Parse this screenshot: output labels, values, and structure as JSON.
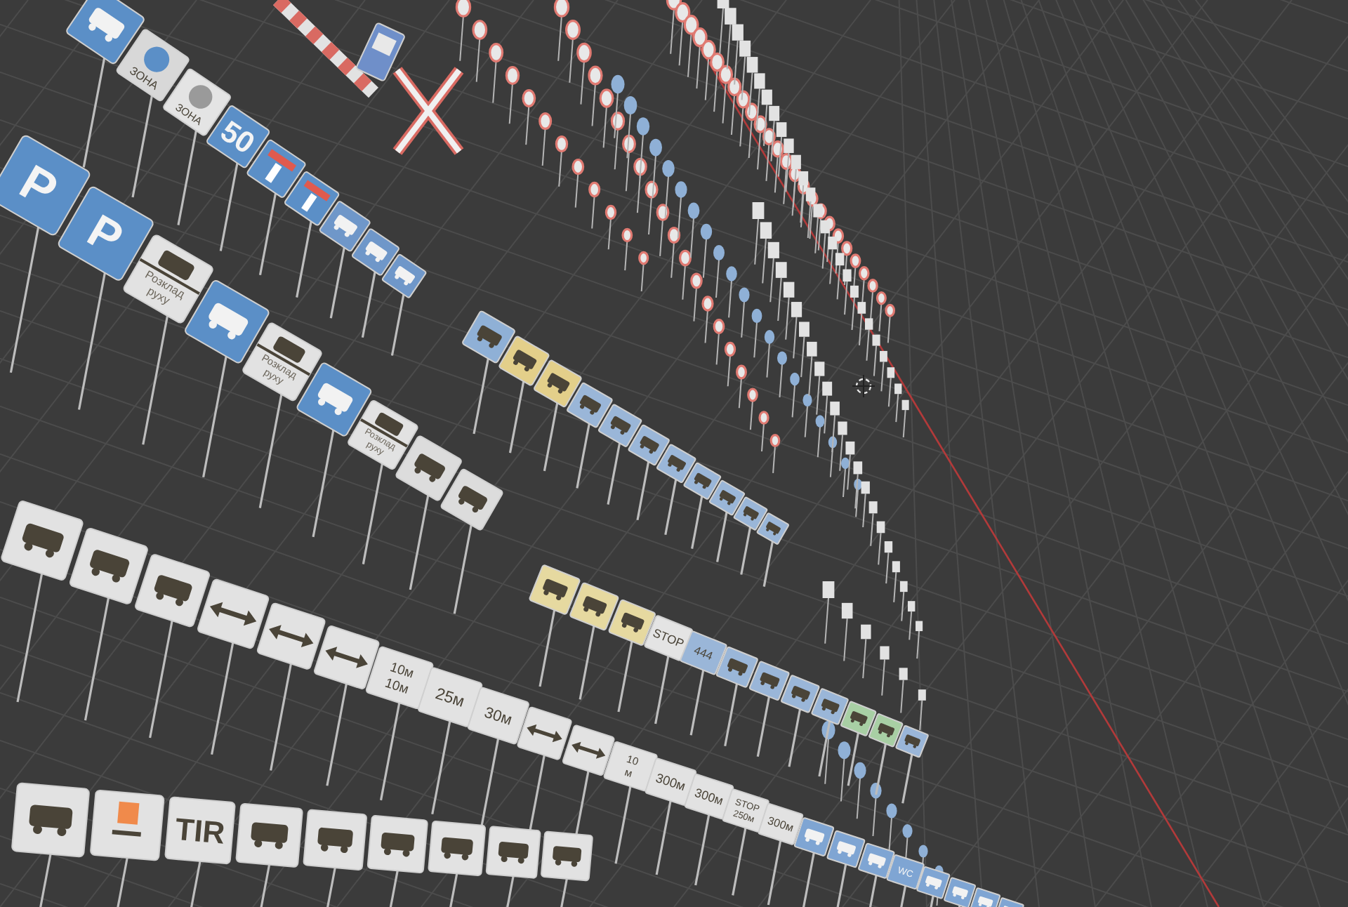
{
  "viewport": {
    "rows": [
      {
        "signs": [
          {
            "kind": "pictogram",
            "color": "#5b8fc7"
          },
          {
            "kind": "zone",
            "color": "#d8d8d8",
            "text": "ЗОНА"
          },
          {
            "kind": "zone",
            "color": "#e4e4e4",
            "text": "ЗОНА"
          },
          {
            "kind": "letter",
            "color": "#5b8fc7",
            "text": "50"
          },
          {
            "kind": "deadend",
            "color": "#5b8fc7"
          },
          {
            "kind": "deadend",
            "color": "#5b8fc7"
          },
          {
            "kind": "pictogram",
            "color": "#6f97c9"
          },
          {
            "kind": "pictogram",
            "color": "#6f97c9"
          },
          {
            "kind": "pictogram",
            "color": "#6f97c9"
          }
        ]
      },
      {
        "signs": [
          {
            "kind": "letter",
            "color": "#5b8fc7",
            "text": "P"
          },
          {
            "kind": "letter",
            "color": "#5b8fc7",
            "text": "P"
          },
          {
            "kind": "timetable",
            "color": "#e2e2e2",
            "text": "Розклад руху"
          },
          {
            "kind": "pictogram",
            "color": "#5b8fc7"
          },
          {
            "kind": "timetable",
            "color": "#e2e2e2",
            "text": "Розклад руху"
          },
          {
            "kind": "pictogram",
            "color": "#5b8fc7"
          },
          {
            "kind": "timetable",
            "color": "#e2e2e2",
            "text": "Розклад руху"
          },
          {
            "kind": "pictogram",
            "color": "#dcdcdc"
          },
          {
            "kind": "pictogram",
            "color": "#dcdcdc"
          }
        ]
      },
      {
        "signs": [
          {
            "kind": "pictogram",
            "color": "#8fb0d6"
          },
          {
            "kind": "pictogram",
            "color": "#e3cf8a"
          },
          {
            "kind": "pictogram",
            "color": "#e3cf8a"
          },
          {
            "kind": "pictogram",
            "color": "#9ab6d8"
          },
          {
            "kind": "pictogram",
            "color": "#9ab6d8"
          },
          {
            "kind": "pictogram",
            "color": "#9ab6d8"
          },
          {
            "kind": "pictogram",
            "color": "#9ab6d8"
          },
          {
            "kind": "pictogram",
            "color": "#9ab6d8"
          },
          {
            "kind": "pictogram",
            "color": "#9ab6d8"
          },
          {
            "kind": "pictogram",
            "color": "#9ab6d8"
          },
          {
            "kind": "pictogram",
            "color": "#9ab6d8"
          }
        ]
      },
      {
        "signs": [
          {
            "kind": "pictogram",
            "color": "#e6d9a0"
          },
          {
            "kind": "pictogram",
            "color": "#e6d9a0"
          },
          {
            "kind": "pictogram",
            "color": "#e6d9a0"
          },
          {
            "kind": "label",
            "color": "#e4e4e4",
            "texts": [
              "STOP"
            ]
          },
          {
            "kind": "label",
            "color": "#9ab6d8",
            "texts": [
              "444"
            ]
          },
          {
            "kind": "pictogram",
            "color": "#9ab6d8"
          },
          {
            "kind": "pictogram",
            "color": "#9ab6d8"
          },
          {
            "kind": "pictogram",
            "color": "#9ab6d8"
          },
          {
            "kind": "pictogram",
            "color": "#9ab6d8"
          },
          {
            "kind": "pictogram",
            "color": "#a8cfa4"
          },
          {
            "kind": "pictogram",
            "color": "#a8cfa4"
          },
          {
            "kind": "pictogram",
            "color": "#9ab6d8"
          }
        ]
      },
      {
        "signs": [
          {
            "kind": "pictogram",
            "color": "#e2e2e2"
          },
          {
            "kind": "pictogram",
            "color": "#e2e2e2"
          },
          {
            "kind": "pictogram",
            "color": "#e2e2e2"
          },
          {
            "kind": "arrow",
            "color": "#e2e2e2"
          },
          {
            "kind": "arrow",
            "color": "#e2e2e2"
          },
          {
            "kind": "arrow",
            "color": "#e2e2e2"
          },
          {
            "kind": "label",
            "color": "#e2e2e2",
            "texts": [
              "10м",
              "10м"
            ]
          },
          {
            "kind": "label",
            "color": "#e2e2e2",
            "texts": [
              "25м"
            ]
          },
          {
            "kind": "label",
            "color": "#e2e2e2",
            "texts": [
              "30м"
            ]
          },
          {
            "kind": "arrow",
            "color": "#e2e2e2"
          },
          {
            "kind": "arrow",
            "color": "#e2e2e2"
          },
          {
            "kind": "label",
            "color": "#e2e2e2",
            "texts": [
              "10",
              "м"
            ]
          },
          {
            "kind": "label",
            "color": "#e2e2e2",
            "texts": [
              "300м"
            ]
          },
          {
            "kind": "label",
            "color": "#e2e2e2",
            "texts": [
              "300м"
            ]
          },
          {
            "kind": "label",
            "color": "#e2e2e2",
            "texts": [
              "STOP",
              "250м"
            ]
          },
          {
            "kind": "label",
            "color": "#e2e2e2",
            "texts": [
              "300м"
            ]
          },
          {
            "kind": "pictogram",
            "color": "#7fa5d3"
          },
          {
            "kind": "pictogram",
            "color": "#7fa5d3"
          },
          {
            "kind": "pictogram",
            "color": "#7fa5d3"
          },
          {
            "kind": "label",
            "color": "#7fa5d3",
            "texts": [
              "WC"
            ]
          },
          {
            "kind": "pictogram",
            "color": "#7fa5d3"
          },
          {
            "kind": "pictogram",
            "color": "#7fa5d3"
          },
          {
            "kind": "pictogram",
            "color": "#7fa5d3"
          },
          {
            "kind": "pictogram",
            "color": "#7fa5d3"
          }
        ]
      },
      {
        "signs": [
          {
            "kind": "pictogram",
            "color": "#e2e2e2"
          },
          {
            "kind": "orange",
            "color": "#e2e2e2"
          },
          {
            "kind": "letter",
            "color": "#e2e2e2",
            "text": "TIR"
          },
          {
            "kind": "pictogram",
            "color": "#e2e2e2"
          },
          {
            "kind": "pictogram",
            "color": "#e2e2e2"
          },
          {
            "kind": "pictogram",
            "color": "#e2e2e2"
          },
          {
            "kind": "pictogram",
            "color": "#e2e2e2"
          },
          {
            "kind": "pictogram",
            "color": "#e2e2e2"
          },
          {
            "kind": "pictogram",
            "color": "#e2e2e2"
          }
        ]
      }
    ]
  }
}
